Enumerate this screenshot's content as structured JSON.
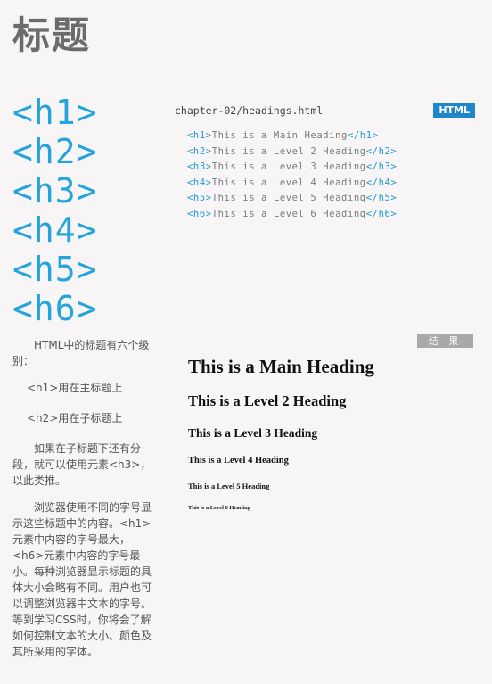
{
  "page_title": "标题",
  "big_tags": [
    "<h1>",
    "<h2>",
    "<h3>",
    "<h4>",
    "<h5>",
    "<h6>"
  ],
  "code_panel": {
    "file_name": "chapter-02/headings.html",
    "badge": "HTML",
    "lines": [
      {
        "open": "<h1>",
        "text": "This is a Main Heading",
        "close": "</h1>"
      },
      {
        "open": "<h2>",
        "text": "This is a Level 2 Heading",
        "close": "</h2>"
      },
      {
        "open": "<h3>",
        "text": "This is a Level 3 Heading",
        "close": "</h3>"
      },
      {
        "open": "<h4>",
        "text": "This is a Level 4 Heading",
        "close": "</h4>"
      },
      {
        "open": "<h5>",
        "text": "This is a Level 5 Heading",
        "close": "</h5>"
      },
      {
        "open": "<h6>",
        "text": "This is a Level 6 Heading",
        "close": "</h6>"
      }
    ]
  },
  "result_panel": {
    "badge": "结 果",
    "headings": [
      "This is a Main Heading",
      "This is a Level 2 Heading",
      "This is a Level 3 Heading",
      "This is a Level 4 Heading",
      "This is a Level 5 Heading",
      "This is a Level 6 Heading"
    ]
  },
  "sidebar": {
    "intro": "HTML中的标题有六个级别：",
    "h1_note": "<h1>用在主标题上",
    "h2_note": "<h2>用在子标题上",
    "subheading_note": "如果在子标题下还有分段，就可以使用元素<h3>，以此类推。",
    "browser_note": "浏览器使用不同的字号显示这些标题中的内容。<h1>元素中内容的字号最大，<h6>元素中内容的字号最小。每种浏览器显示标题的具体大小会略有不同。用户也可以调整浏览器中文本的字号。等到学习CSS时，你将会了解如何控制文本的大小、颜色及其所采用的字体。"
  }
}
